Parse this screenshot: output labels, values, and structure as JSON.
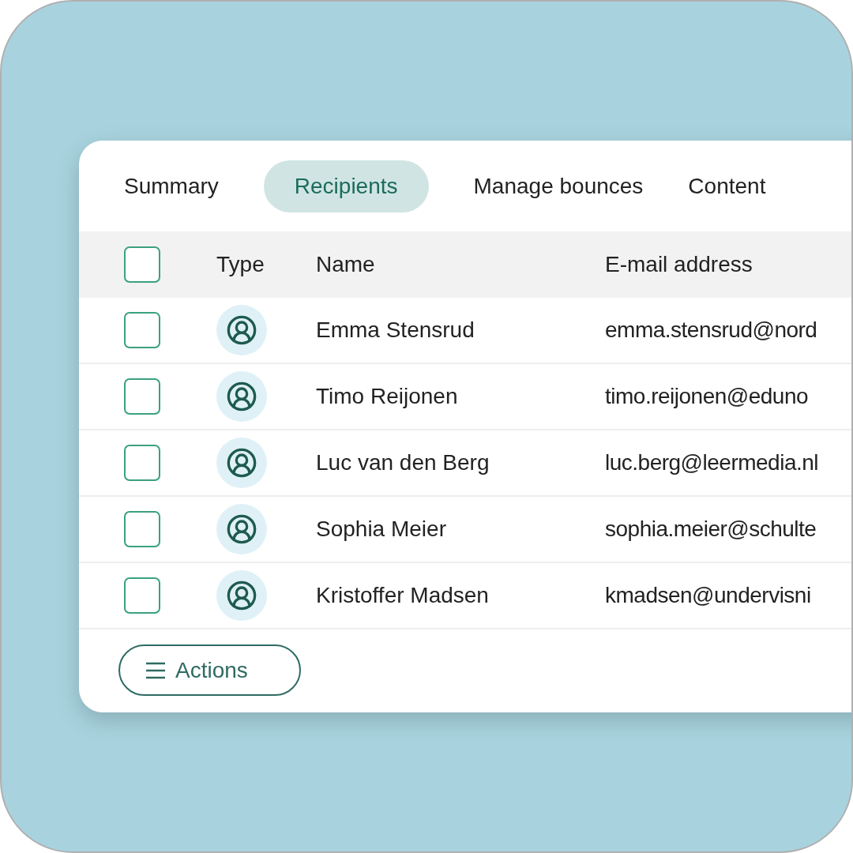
{
  "tabs": [
    {
      "label": "Summary",
      "selected": false
    },
    {
      "label": "Recipients",
      "selected": true
    },
    {
      "label": "Manage bounces",
      "selected": false
    },
    {
      "label": "Content",
      "selected": false
    }
  ],
  "table": {
    "header": {
      "checked": false,
      "columns": [
        "Type",
        "Name",
        "E-mail address"
      ]
    },
    "rows": [
      {
        "checked": false,
        "name": "Emma Stensrud",
        "email": "emma.stensrud@nord"
      },
      {
        "checked": false,
        "name": "Timo Reijonen",
        "email": "timo.reijonen@eduno"
      },
      {
        "checked": false,
        "name": "Luc van den Berg",
        "email": "luc.berg@leermedia.nl"
      },
      {
        "checked": false,
        "name": "Sophia Meier",
        "email": "sophia.meier@schulte"
      },
      {
        "checked": false,
        "name": "Kristoffer Madsen",
        "email": "kmadsen@undervisni"
      }
    ]
  },
  "actions_button": {
    "label": "Actions"
  }
}
